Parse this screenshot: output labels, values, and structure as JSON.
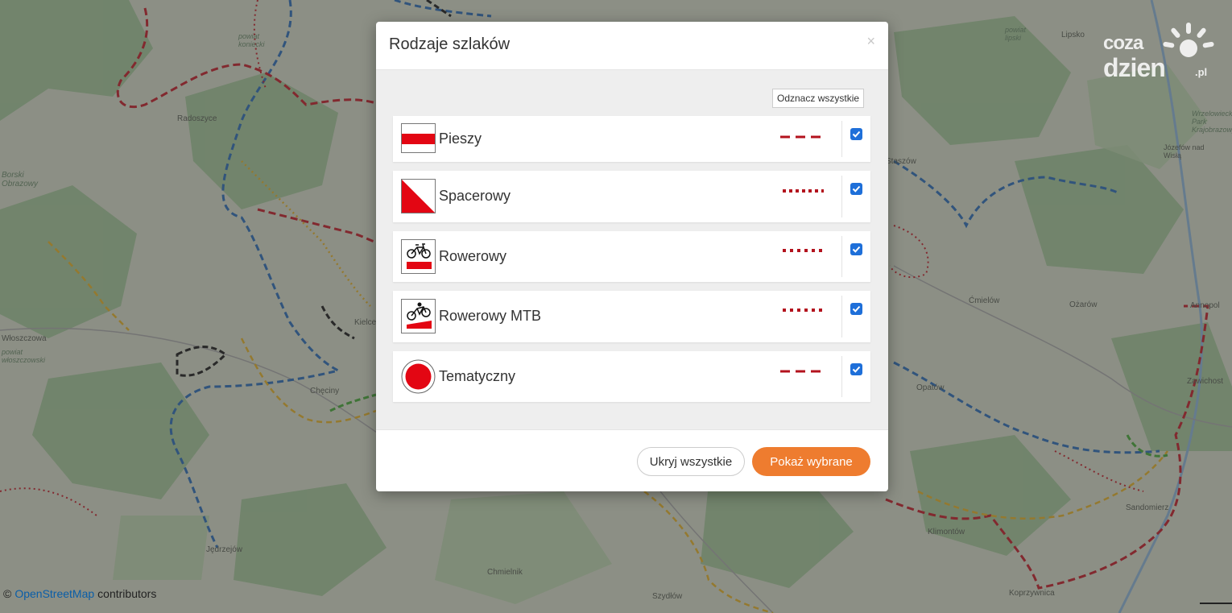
{
  "map": {
    "place_labels": [
      "Lipsko",
      "Radoszyce",
      "Józefów nad Wisłą",
      "Ćmielów",
      "Ożarów",
      "Opatów",
      "Klimontów",
      "Chmielnik",
      "Szydłów",
      "Koprzywnica",
      "Jędrzejów"
    ],
    "area_labels": [
      "Borski Obrazowy",
      "Wrzelowiecki Park Krajobrazowy",
      "powiat koniecki",
      "powiat lipski",
      "powiat włoszczowski",
      "Włoszczowa",
      "Chęciny",
      "Kielce",
      "Staszów",
      "Sandomierz",
      "Zawichost",
      "Annopol"
    ]
  },
  "logo": {
    "line1": "coza",
    "line2": "dzien",
    "suffix": ".pl"
  },
  "attribution": {
    "copyright": "©",
    "link": "OpenStreetMap",
    "suffix": "contributors"
  },
  "modal": {
    "title": "Rodzaje szlaków",
    "close_symbol": "×",
    "deselect_all": "Odznacz wszystkie",
    "trails": [
      {
        "label": "Pieszy",
        "icon": "hiking-marker-icon",
        "line_style": "dashed",
        "checked": true
      },
      {
        "label": "Spacerowy",
        "icon": "walking-marker-icon",
        "line_style": "dotted",
        "checked": true
      },
      {
        "label": "Rowerowy",
        "icon": "bicycle-marker-icon",
        "line_style": "dotted",
        "checked": true
      },
      {
        "label": "Rowerowy MTB",
        "icon": "mtb-marker-icon",
        "line_style": "dotted",
        "checked": true
      },
      {
        "label": "Tematyczny",
        "icon": "thematic-marker-icon",
        "line_style": "dashed",
        "checked": true
      }
    ],
    "hide_all": "Ukryj wszystkie",
    "show_selected": "Pokaż wybrane"
  },
  "colors": {
    "trail_red": "#e30613",
    "line_dark_red": "#b3121d",
    "accent_orange": "#ee7c2f",
    "checkbox_blue": "#1e6fd9",
    "route_blue": "#1f5fa8",
    "route_yellow": "#d4a21c"
  }
}
